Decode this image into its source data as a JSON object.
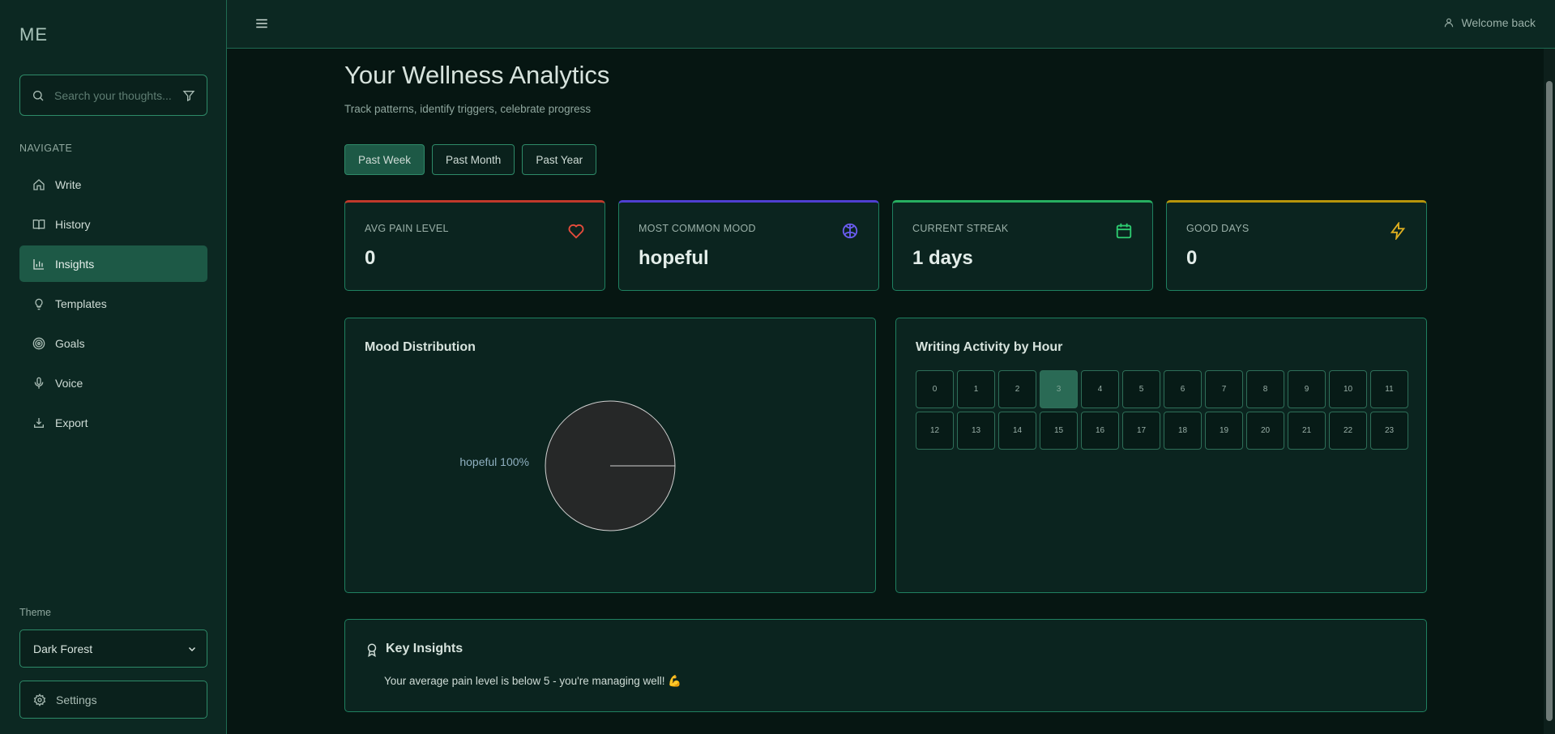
{
  "app": {
    "logo": "ME",
    "welcome": "Welcome back"
  },
  "sidebar": {
    "search_placeholder": "Search your thoughts...",
    "nav_heading": "NAVIGATE",
    "items": [
      {
        "label": "Write",
        "icon": "home-icon"
      },
      {
        "label": "History",
        "icon": "book-icon"
      },
      {
        "label": "Insights",
        "icon": "bar-chart-icon",
        "active": true
      },
      {
        "label": "Templates",
        "icon": "lightbulb-icon"
      },
      {
        "label": "Goals",
        "icon": "target-icon"
      },
      {
        "label": "Voice",
        "icon": "microphone-icon"
      },
      {
        "label": "Export",
        "icon": "download-icon"
      }
    ],
    "theme_label": "Theme",
    "theme_value": "Dark Forest",
    "settings_label": "Settings"
  },
  "page": {
    "title": "Your Wellness Analytics",
    "subtitle": "Track patterns, identify triggers, celebrate progress",
    "ranges": [
      "Past Week",
      "Past Month",
      "Past Year"
    ],
    "selected_range": "Past Week"
  },
  "stats": [
    {
      "label": "AVG PAIN LEVEL",
      "value": "0",
      "icon": "heart-icon",
      "accent": "#c0392b"
    },
    {
      "label": "MOST COMMON MOOD",
      "value": "hopeful",
      "icon": "brain-icon",
      "accent": "#4f3fd1"
    },
    {
      "label": "CURRENT STREAK",
      "value": "1 days",
      "icon": "calendar-icon",
      "accent": "#27ae60"
    },
    {
      "label": "GOOD DAYS",
      "value": "0",
      "icon": "lightning-icon",
      "accent": "#b7950b"
    }
  ],
  "mood_panel": {
    "title": "Mood Distribution"
  },
  "activity_panel": {
    "title": "Writing Activity by Hour",
    "hours": [
      "0",
      "1",
      "2",
      "3",
      "4",
      "5",
      "6",
      "7",
      "8",
      "9",
      "10",
      "11",
      "12",
      "13",
      "14",
      "15",
      "16",
      "17",
      "18",
      "19",
      "20",
      "21",
      "22",
      "23"
    ],
    "active_hour": "3"
  },
  "insights": {
    "title": "Key Insights",
    "text": "Your average pain level is below 5 - you're managing well! 💪"
  },
  "chart_data": {
    "type": "pie",
    "categories": [
      "hopeful"
    ],
    "values": [
      100
    ],
    "data_labels": [
      "hopeful 100%"
    ]
  },
  "colors": {
    "accent": "#1d5946",
    "border": "#2e8a68",
    "background": "#061612"
  }
}
